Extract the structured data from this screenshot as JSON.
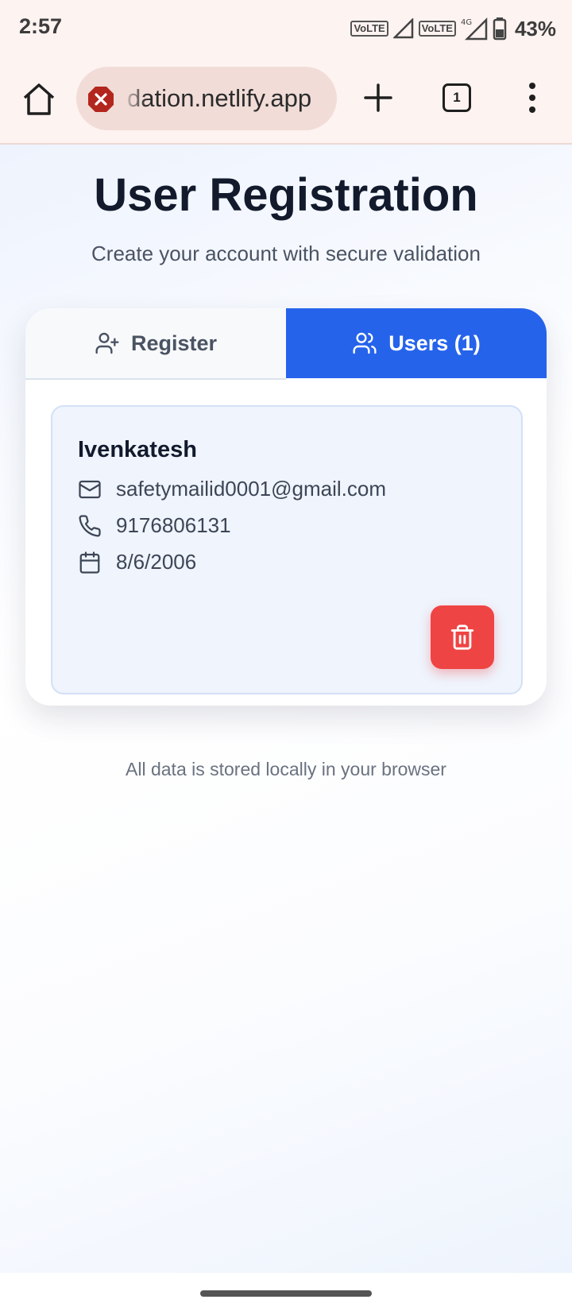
{
  "status_bar": {
    "time": "2:57",
    "sim1_badge": "VoLTE",
    "sim2_badge": "VoLTE",
    "network_type": "4G",
    "battery": "43%"
  },
  "browser": {
    "url": "dation.netlify.app",
    "tab_count": "1",
    "security_state": "not-secure"
  },
  "page": {
    "title": "User Registration",
    "subtitle": "Create your account with secure validation",
    "tabs": [
      {
        "label": "Register",
        "icon": "user-plus-icon",
        "active": false
      },
      {
        "label": "Users (1)",
        "icon": "users-icon",
        "active": true
      }
    ],
    "users": [
      {
        "name": "Ivenkatesh",
        "email": "safetymailid0001@gmail.com",
        "phone": "9176806131",
        "dob": "8/6/2006"
      }
    ],
    "footer_note": "All data is stored locally in your browser"
  },
  "colors": {
    "accent": "#2563eb",
    "danger": "#ef4444",
    "title": "#121a2c"
  }
}
